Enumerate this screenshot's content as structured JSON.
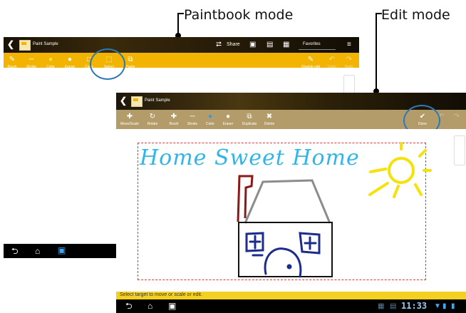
{
  "callouts": {
    "paintbook": "Paintbook mode",
    "edit": "Edit mode"
  },
  "paintbook": {
    "title": "Paint Sample",
    "share_label": "Share",
    "favorites_label": "Favorites",
    "tools": [
      {
        "label": "Brush",
        "icon": "brush-icon",
        "glyph": "✎"
      },
      {
        "label": "Stroke",
        "icon": "stroke-icon",
        "glyph": "─"
      },
      {
        "label": "Color",
        "icon": "color-icon",
        "glyph": "●"
      },
      {
        "label": "Eraser",
        "icon": "eraser-icon",
        "glyph": "●"
      },
      {
        "label": "Clear",
        "icon": "clear-icon",
        "glyph": "□"
      },
      {
        "label": "Select",
        "icon": "select-icon",
        "glyph": "⬚"
      },
      {
        "label": "Paste",
        "icon": "paste-icon",
        "glyph": "⧉"
      }
    ],
    "right_tools": [
      {
        "label": "Disable edit",
        "icon": "disable-edit-icon",
        "glyph": "✎"
      },
      {
        "label": "Undo",
        "icon": "undo-icon",
        "glyph": "↶"
      },
      {
        "label": "Redo",
        "icon": "redo-icon",
        "glyph": "↷"
      }
    ]
  },
  "edit": {
    "title": "Paint Sample",
    "tools": [
      {
        "label": "Move/Scale",
        "icon": "move-scale-icon",
        "glyph": "✚"
      },
      {
        "label": "Rotate",
        "icon": "rotate-icon",
        "glyph": "↻"
      },
      {
        "label": "Brush",
        "icon": "brush-icon",
        "glyph": "✚"
      },
      {
        "label": "Stroke",
        "icon": "stroke-icon",
        "glyph": "─"
      },
      {
        "label": "Color",
        "icon": "color-icon",
        "glyph": "●"
      },
      {
        "label": "Eraser",
        "icon": "eraser-icon",
        "glyph": "●"
      },
      {
        "label": "Duplicate",
        "icon": "duplicate-icon",
        "glyph": "⧉"
      },
      {
        "label": "Delete",
        "icon": "delete-icon",
        "glyph": "✖"
      }
    ],
    "done_label": "Done",
    "canvas_text": "Home Sweet Home",
    "status_text": "Select target to move or scale or edit.",
    "clock": "11:33"
  },
  "colors": {
    "accent_yellow": "#f2b400",
    "edit_toolbar": "#b39c6a",
    "circle_blue": "#2b78b8",
    "selection_red": "#d23a3a"
  }
}
